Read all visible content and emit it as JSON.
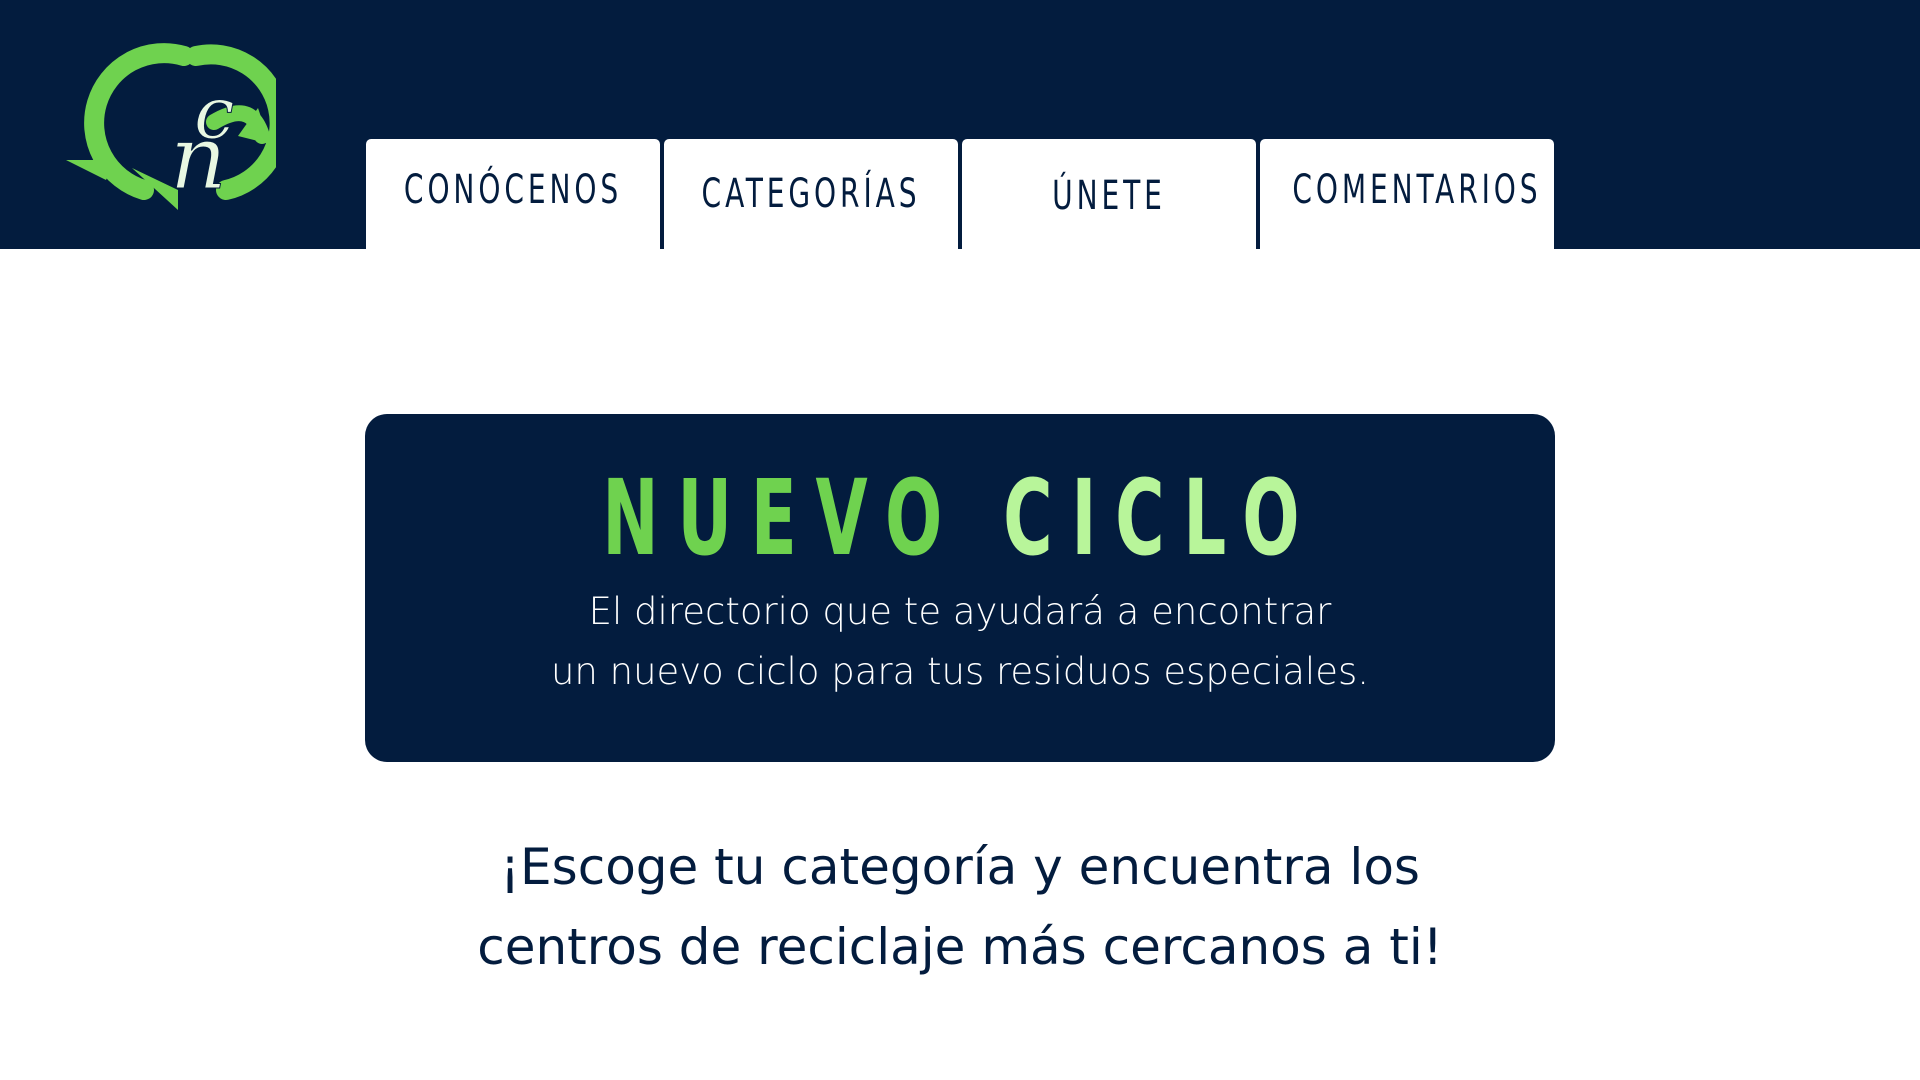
{
  "brand": {
    "logo_text": "nc",
    "colors": {
      "navy": "#031c3e",
      "green": "#6fd24f",
      "light_green": "#b8f59a",
      "white": "#ffffff"
    }
  },
  "nav": {
    "tabs": [
      {
        "label": "CONÓCENOS"
      },
      {
        "label": "CATEGORÍAS"
      },
      {
        "label": "ÚNETE"
      },
      {
        "label": "COMENTARIOS"
      }
    ]
  },
  "hero": {
    "title_word1": "NUEVO",
    "title_word2": "CICLO",
    "subtitle_line1": "El directorio que te ayudará a encontrar",
    "subtitle_line2": "un nuevo ciclo para tus residuos especiales."
  },
  "cta": {
    "line1": "¡Escoge tu categoría y encuentra los",
    "line2": "centros de reciclaje más cercanos a ti!"
  }
}
